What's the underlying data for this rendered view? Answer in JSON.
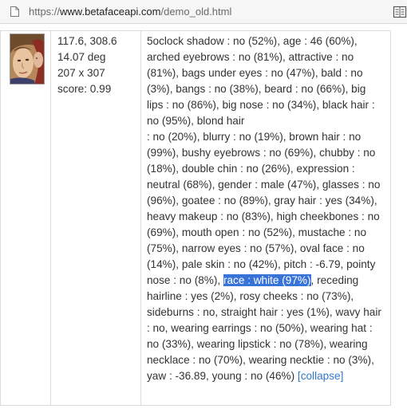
{
  "browser": {
    "url_protocol": "https://",
    "url_host": "www.betafaceapi.com",
    "url_path": "/demo_old.html"
  },
  "face_result": {
    "position": "117.6, 308.6",
    "angle": "14.07 deg",
    "size": "207 x 307",
    "score": "score: 0.99"
  },
  "attributes": {
    "text_before_highlight": "5oclock shadow : no (52%), age : 46 (60%), arched eyebrows : no (81%), attractive : no (81%), bags under eyes : no (47%), bald : no (3%), bangs : no (38%), beard : no (66%), big lips : no (86%), big nose : no (34%), black hair : no (95%), blond hair",
    "text_middle": ": no (20%), blurry : no (19%), brown hair : no (99%), bushy eyebrows : no (69%), chubby : no (18%), double chin : no (26%), expression : neutral (68%), gender : male (47%), glasses : no (96%), goatee : no (89%), gray hair : yes (34%), heavy makeup : no (83%), high cheekbones : no (69%), mouth open : no (52%), mustache : no (75%), narrow eyes : no (57%), oval face : no (14%), pale skin : no (42%), pitch : -6.79, pointy nose : no (8%),",
    "highlighted": "race : white (97%)",
    "text_after_highlight": ", receding hairline : yes (2%), rosy cheeks : no (73%), sideburns : no, straight hair : yes (1%), wavy hair : no, wearing earrings : no (50%), wearing hat : no (33%), wearing lipstick : no (78%), wearing necklace : no (70%), wearing necktie : no (3%), yaw : -36.89, young : no (46%)",
    "collapse_label": "[collapse]"
  },
  "colors": {
    "highlight_bg": "#3874d8",
    "link": "#3377cc",
    "text": "#333333"
  }
}
